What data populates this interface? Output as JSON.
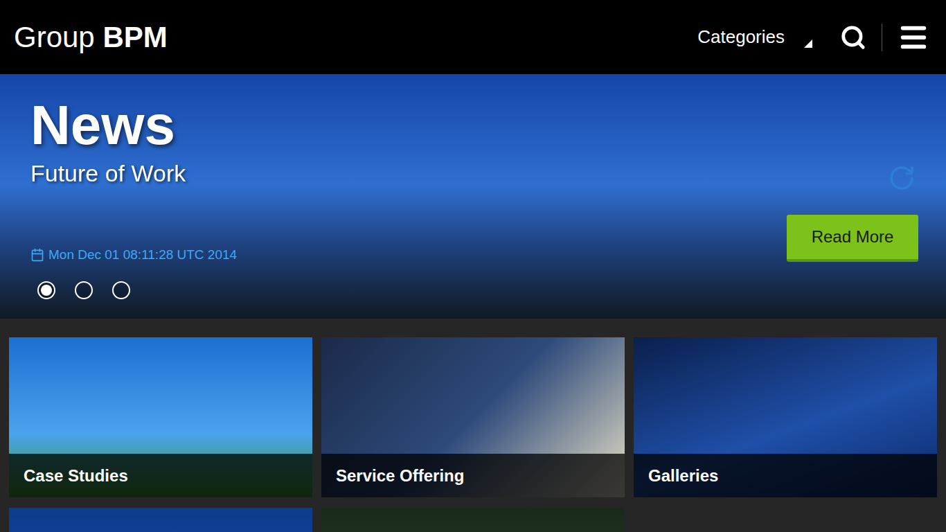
{
  "header": {
    "title_light": "Group",
    "title_bold": "BPM",
    "nav": [
      {
        "label": "Categories"
      }
    ]
  },
  "hero": {
    "heading": "News",
    "subtitle": "Future of Work",
    "date": "Mon Dec 01 08:11:28 UTC 2014",
    "button": "Read More",
    "slides": [
      {
        "selected": true
      },
      {
        "selected": false
      },
      {
        "selected": false
      }
    ]
  },
  "tiles": [
    {
      "label": "Case Studies"
    },
    {
      "label": "Service Offering"
    },
    {
      "label": "Galleries"
    },
    {
      "label": ""
    },
    {
      "label": ""
    }
  ]
}
